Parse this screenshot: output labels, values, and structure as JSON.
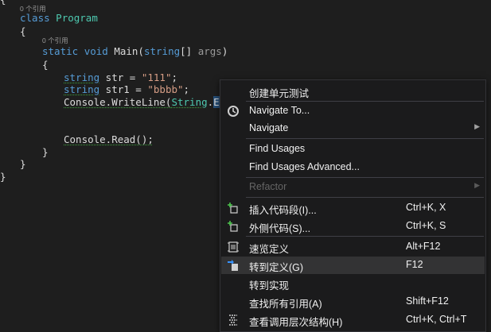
{
  "code": {
    "lens_program": "0 个引用",
    "lens_main": "0 个引用",
    "line_top_brace": "{",
    "kw_class": "class",
    "class_name": "Program",
    "open_brace_1": "{",
    "kw_static": "static",
    "kw_void": "void",
    "method_main": "Main(",
    "kw_string_param": "string",
    "param_tail": "[] ",
    "param_args": "args",
    "close_paren": ")",
    "open_brace_2": "{",
    "kw_string1": "string",
    "decl1": " str = ",
    "val1": "\"111\"",
    "semi1": ";",
    "kw_string2": "string",
    "decl2": " str1 = ",
    "val2": "\"bbbb\"",
    "semi2": ";",
    "console1": "Console.WriteLine(",
    "string_type": "String",
    "dot": ".",
    "equals_partial": "Equa",
    "console_read": "Console.Read();",
    "close_brace_2": "}",
    "close_brace_1": "}",
    "close_brace_0": "}"
  },
  "context_menu": {
    "items": [
      {
        "label": "创建单元测试",
        "shortcut": "",
        "icon": "",
        "submenu": false,
        "disabled": false
      },
      {
        "label": "Navigate To...",
        "shortcut": "",
        "icon": "navigate-to-icon",
        "submenu": false,
        "disabled": false
      },
      {
        "label": "Navigate",
        "shortcut": "",
        "icon": "",
        "submenu": true,
        "disabled": false
      },
      {
        "label": "Find Usages",
        "shortcut": "",
        "icon": "",
        "submenu": false,
        "disabled": false
      },
      {
        "label": "Find Usages Advanced...",
        "shortcut": "",
        "icon": "",
        "submenu": false,
        "disabled": false
      },
      {
        "label": "Refactor",
        "shortcut": "",
        "icon": "",
        "submenu": true,
        "disabled": true
      },
      {
        "label": "插入代码段(I)...",
        "shortcut": "Ctrl+K, X",
        "icon": "insert-snippet-icon",
        "submenu": false,
        "disabled": false
      },
      {
        "label": "外侧代码(S)...",
        "shortcut": "Ctrl+K, S",
        "icon": "surround-with-icon",
        "submenu": false,
        "disabled": false
      },
      {
        "label": "速览定义",
        "shortcut": "Alt+F12",
        "icon": "peek-definition-icon",
        "submenu": false,
        "disabled": false
      },
      {
        "label": "转到定义(G)",
        "shortcut": "F12",
        "icon": "go-to-definition-icon",
        "submenu": false,
        "disabled": false,
        "highlighted": true
      },
      {
        "label": "转到实现",
        "shortcut": "",
        "icon": "",
        "submenu": false,
        "disabled": false
      },
      {
        "label": "查找所有引用(A)",
        "shortcut": "Shift+F12",
        "icon": "",
        "submenu": false,
        "disabled": false
      },
      {
        "label": "查看调用层次结构(H)",
        "shortcut": "Ctrl+K, Ctrl+T",
        "icon": "call-hierarchy-icon",
        "submenu": false,
        "disabled": false
      }
    ]
  },
  "colors": {
    "editor_bg": "#1e1e1e",
    "keyword": "#569cd6",
    "type": "#4ec9b0",
    "string": "#d69d85",
    "menu_bg": "#1b1b1c",
    "menu_highlight": "#333334"
  }
}
